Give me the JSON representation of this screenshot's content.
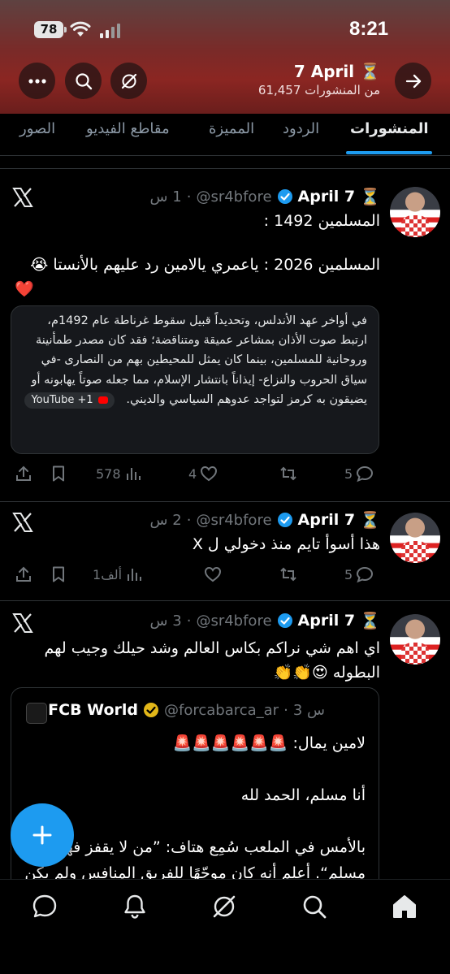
{
  "status_bar": {
    "battery": "78",
    "time": "8:21"
  },
  "header": {
    "title": "7 April",
    "title_icon": "hourglass-icon",
    "subtitle": "61,457 من المنشورات",
    "buttons": [
      "back-icon",
      "grok-icon",
      "search-icon",
      "more-icon"
    ]
  },
  "tabs": [
    {
      "label": "المنشورات",
      "active": true
    },
    {
      "label": "الردود"
    },
    {
      "label": "المميزة"
    },
    {
      "label": "مقاطع الفيديو"
    },
    {
      "label": "الصور"
    }
  ],
  "posts": [
    {
      "name": "7 April",
      "handle": "@sr4bfore",
      "time": "1 س",
      "text_lines": [
        "المسلمين 1492 :",
        "المسلمين 2026 : ياعمري يالامين رد عليهم بالأنستا 😭",
        "❤️"
      ],
      "card": {
        "text": "في أواخر عهد الأندلس، وتحديداً قبيل سقوط غرناطة عام 1492م، ارتبط صوت الأذان بمشاعر عميقة ومتناقضة؛ فقد كان مصدر طمأنينة وروحانية للمسلمين، بينما كان يمثل للمحيطين بهم من النصارى -في سياق الحروب والنزاع- إيذاناً بانتشار الإسلام، مما جعله صوتاً يهابونه أو يضيقون به كرمز لتواجد عدوهم السياسي والديني.",
        "badge": "YouTube +1"
      },
      "stats": {
        "replies": "5",
        "reposts": "",
        "likes": "4",
        "views": "578"
      }
    },
    {
      "name": "7 April",
      "handle": "@sr4bfore",
      "time": "2 س",
      "text_lines": [
        "هذا أسوأ تايم منذ دخولي ل X"
      ],
      "stats": {
        "replies": "5",
        "reposts": "",
        "likes": "",
        "views": "1ألف"
      }
    },
    {
      "name": "7 April",
      "handle": "@sr4bfore",
      "time": "3 س",
      "text_lines": [
        "اي اهم شي نراكم بكاس العالم وشد حيلك وجيب لهم",
        "البطوله 😍👏👏"
      ],
      "quote": {
        "name": "FCB World",
        "handle": "@forcabarca_ar",
        "time": "3 س",
        "body": "لامين يمال: 🚨🚨🚨🚨🚨🚨\n\nأنا مسلم، الحمد لله\n\nبالأمس في الملعب سُمِع هتاف: ”من لا يقفز فهو مسلم“. أعلم أنه كان موجّهًا للفريق المنافس ولم يكن شيئًا شخصيًا ضدي، لكن بصفتي مسلمًا، فهذا لا"
      }
    }
  ],
  "bottom_nav": [
    "home-icon",
    "search-icon",
    "grok-icon",
    "notifications-icon",
    "messages-icon"
  ],
  "fab": {
    "icon": "plus-icon"
  },
  "colors": {
    "accent": "#1d9bf0",
    "header_red": "#8b2622",
    "muted": "#71767b"
  }
}
